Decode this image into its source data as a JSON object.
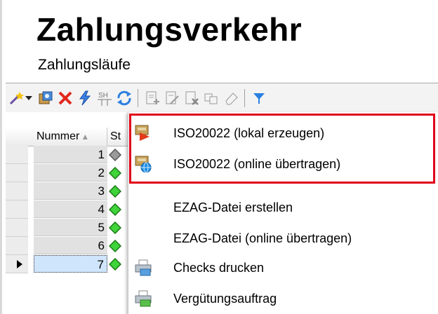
{
  "page": {
    "title": "Zahlungsverkehr",
    "subtitle": "Zahlungsläufe"
  },
  "toolbar": {
    "buttons": [
      "new-wizard-icon",
      "dropdown-arrow-icon",
      "open-icon",
      "delete-icon",
      "run-icon",
      "sh-icon",
      "refresh-icon",
      "doc-add-icon",
      "doc-edit-icon",
      "doc-delete-icon",
      "doc-copy-icon",
      "eraser-icon",
      "filter-icon"
    ],
    "sh_text": "SH"
  },
  "grid": {
    "columns": {
      "number": "Nummer",
      "status": "St"
    },
    "rows": [
      {
        "number": "1",
        "status": "gray"
      },
      {
        "number": "2",
        "status": "green"
      },
      {
        "number": "3",
        "status": "green"
      },
      {
        "number": "4",
        "status": "green"
      },
      {
        "number": "5",
        "status": "green"
      },
      {
        "number": "6",
        "status": "green"
      },
      {
        "number": "7",
        "status": "green"
      }
    ]
  },
  "context_menu": {
    "items": [
      {
        "label": "ISO20022 (lokal erzeugen)",
        "icon": "iso-local-icon"
      },
      {
        "label": "ISO20022 (online übertragen)",
        "icon": "iso-online-icon"
      },
      {
        "label": "EZAG-Datei erstellen",
        "icon": ""
      },
      {
        "label": "EZAG-Datei (online übertragen)",
        "icon": ""
      },
      {
        "label": "Checks drucken",
        "icon": "print-checks-icon"
      },
      {
        "label": "Vergütungsauftrag",
        "icon": "payment-order-icon"
      }
    ],
    "highlight_color": "#e0001a"
  }
}
